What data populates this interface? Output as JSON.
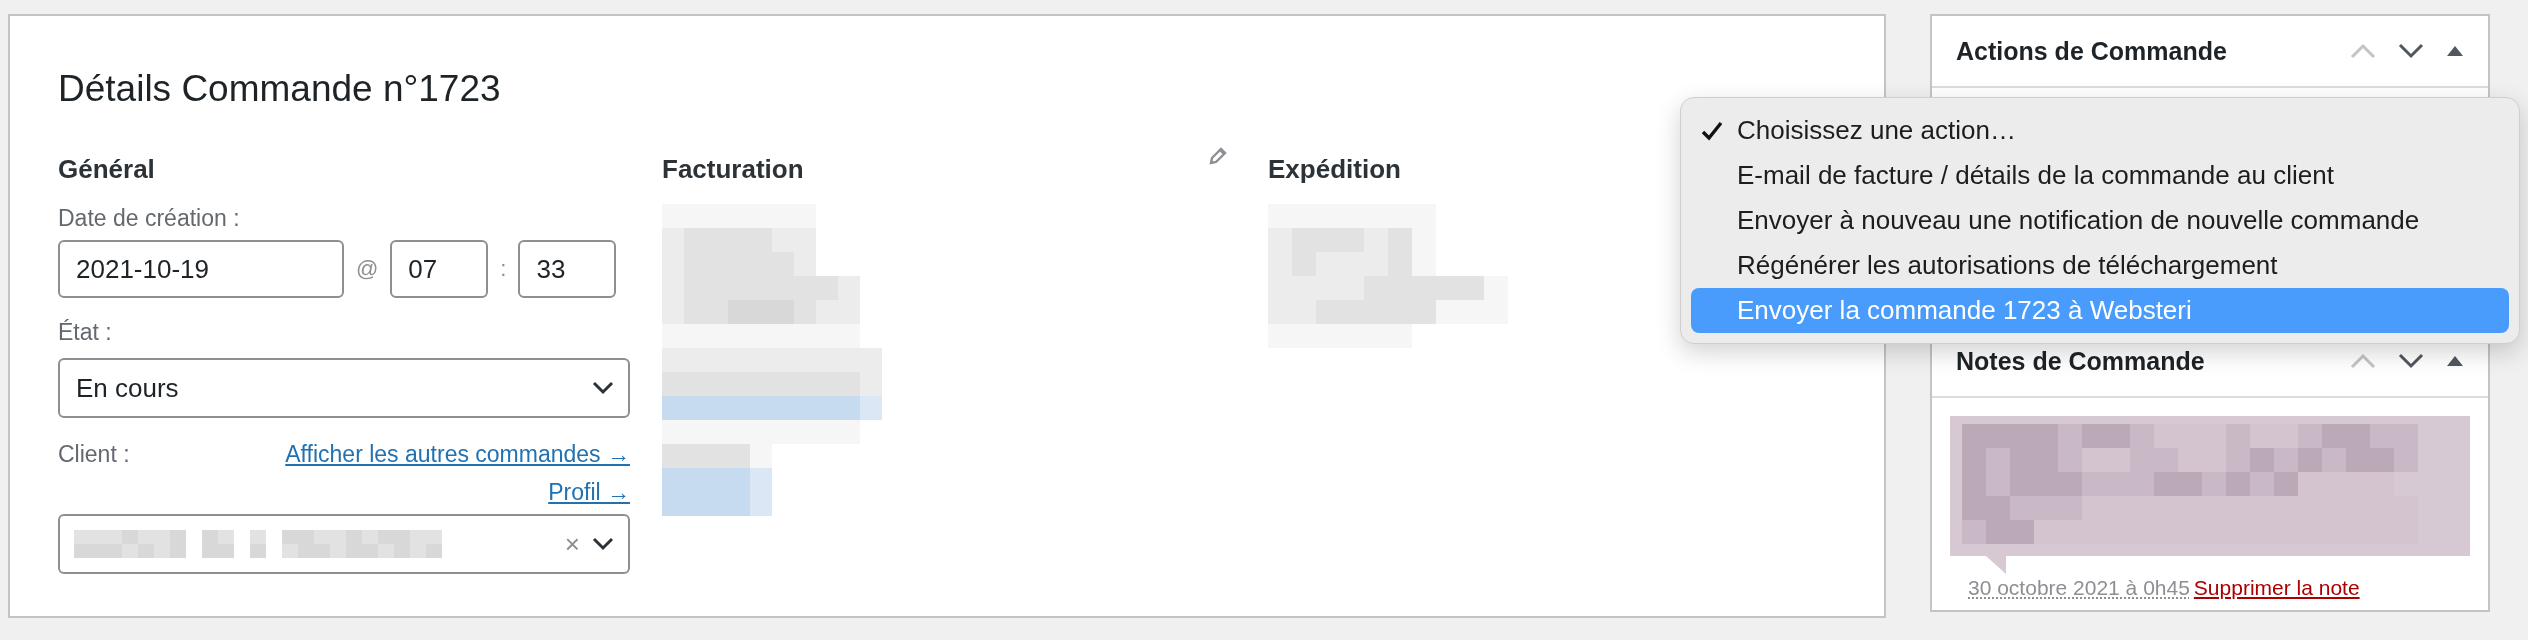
{
  "order": {
    "title": "Détails Commande n°1723"
  },
  "general": {
    "heading": "Général",
    "date_label": "Date de création :",
    "date": "2021-10-19",
    "at": "@",
    "hour": "07",
    "colon": ":",
    "minute": "33",
    "status_label": "État :",
    "status": "En cours",
    "client_label": "Client :",
    "links": [
      "Afficher les autres commandes →",
      "Profil →"
    ],
    "clear": "×"
  },
  "billing": {
    "heading": "Facturation"
  },
  "shipping": {
    "heading": "Expédition"
  },
  "sidebar": {
    "panels": [
      {
        "title": "Actions de Commande"
      },
      {
        "title": "Notes de Commande"
      }
    ]
  },
  "note": {
    "date": "30 octobre 2021 à 0h45",
    "delete_link": "Supprimer la note"
  },
  "action_menu": {
    "items": [
      {
        "label": "Choisissez une action…",
        "checked": true,
        "selected": false
      },
      {
        "label": "E-mail de facture / détails de la commande au client",
        "checked": false,
        "selected": false
      },
      {
        "label": "Envoyer à nouveau une notification de nouvelle commande",
        "checked": false,
        "selected": false
      },
      {
        "label": "Régénérer les autorisations de téléchargement",
        "checked": false,
        "selected": false
      },
      {
        "label": "Envoyer la commande 1723 à Websteri",
        "checked": false,
        "selected": true
      }
    ]
  }
}
